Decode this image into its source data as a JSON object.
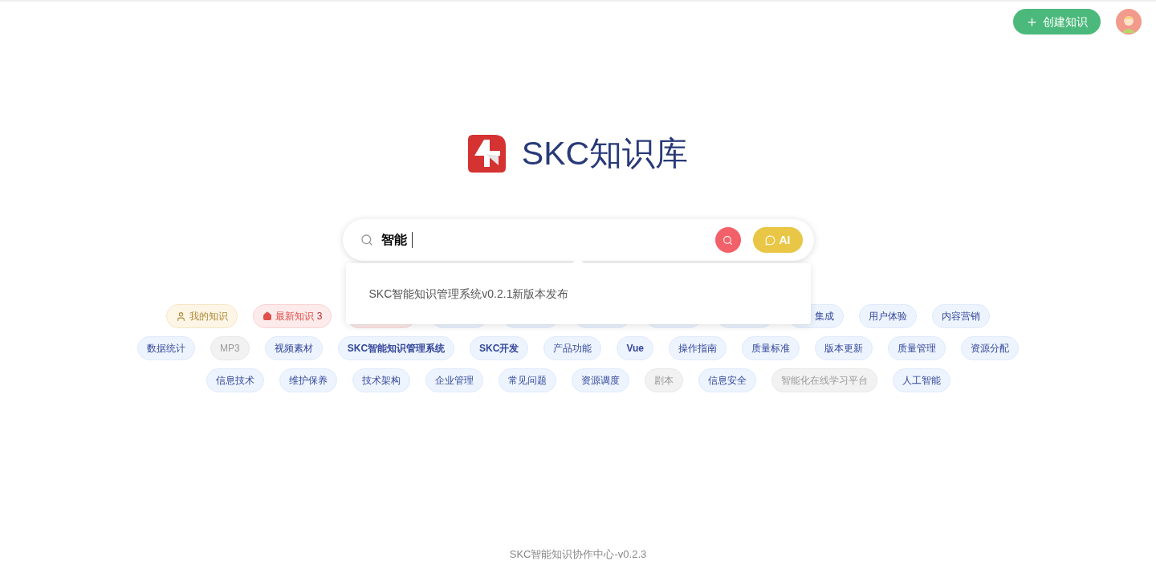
{
  "header": {
    "create_button": "创建知识"
  },
  "brand": {
    "title": "SKC知识库"
  },
  "search": {
    "value": "智能",
    "ai_button": "AI"
  },
  "suggestions": [
    {
      "text": "SKC智能知识管理系统v0.2.1新版本发布"
    }
  ],
  "tag_rows": [
    [
      {
        "kind": "mine",
        "label": "我的知识"
      },
      {
        "kind": "latest",
        "label": "最新知识",
        "count": "3"
      },
      {
        "kind": "red-hidden"
      },
      {
        "kind": "blue-hidden"
      },
      {
        "kind": "blue-hidden"
      },
      {
        "kind": "blue-hidden"
      },
      {
        "kind": "blue-hidden"
      },
      {
        "kind": "blue-hidden"
      },
      {
        "kind": "blue-partial",
        "label": "集成"
      },
      {
        "kind": "blue",
        "label": "用户体验"
      },
      {
        "kind": "blue",
        "label": "内容营销"
      }
    ],
    [
      {
        "kind": "blue",
        "label": "数据统计"
      },
      {
        "kind": "grey",
        "label": "MP3"
      },
      {
        "kind": "blue",
        "label": "视频素材"
      },
      {
        "kind": "blue-bold",
        "label": "SKC智能知识管理系统"
      },
      {
        "kind": "blue-bold",
        "label": "SKC开发"
      },
      {
        "kind": "blue",
        "label": "产品功能"
      },
      {
        "kind": "blue-bold",
        "label": "Vue"
      },
      {
        "kind": "blue",
        "label": "操作指南"
      },
      {
        "kind": "blue",
        "label": "质量标准"
      },
      {
        "kind": "blue",
        "label": "版本更新"
      },
      {
        "kind": "blue",
        "label": "质量管理"
      },
      {
        "kind": "blue",
        "label": "资源分配"
      }
    ],
    [
      {
        "kind": "blue",
        "label": "信息技术"
      },
      {
        "kind": "blue",
        "label": "维护保养"
      },
      {
        "kind": "blue",
        "label": "技术架构"
      },
      {
        "kind": "blue",
        "label": "企业管理"
      },
      {
        "kind": "blue",
        "label": "常见问题"
      },
      {
        "kind": "blue",
        "label": "资源调度"
      },
      {
        "kind": "grey",
        "label": "剧本"
      },
      {
        "kind": "blue",
        "label": "信息安全"
      },
      {
        "kind": "grey",
        "label": "智能化在线学习平台"
      },
      {
        "kind": "blue",
        "label": "人工智能"
      }
    ]
  ],
  "footer": {
    "text": "SKC智能知识协作中心-v0.2.3"
  }
}
